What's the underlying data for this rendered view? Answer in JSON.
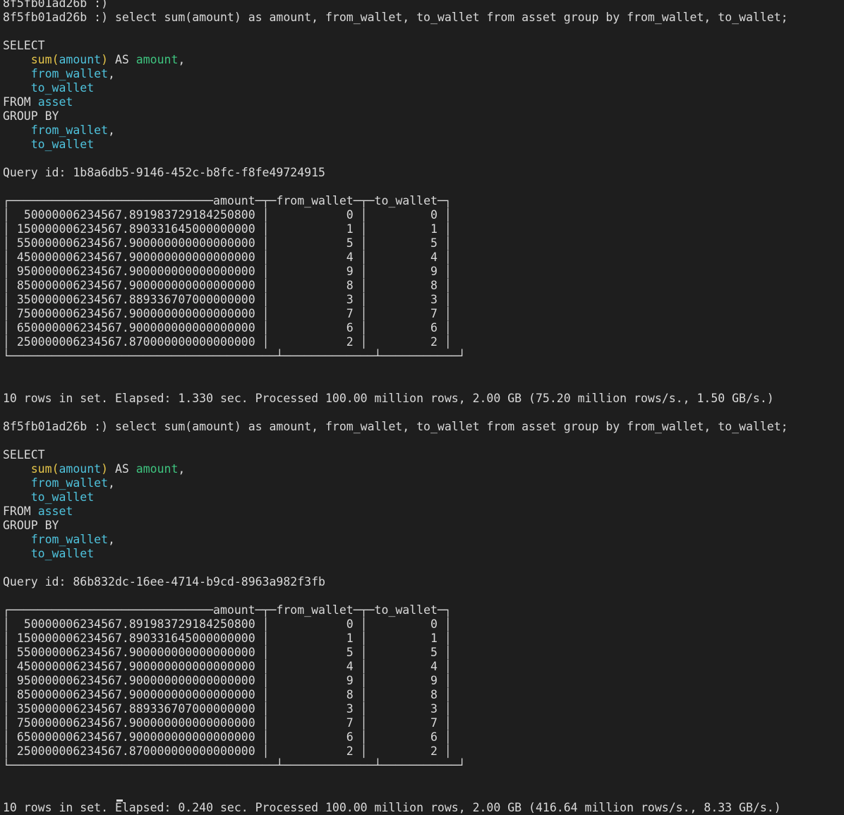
{
  "prompt": "8f5fb01ad26b :)",
  "query": "select sum(amount) as amount, from_wallet, to_wallet from asset group by from_wallet, to_wallet;",
  "formatted_sql": {
    "select": "SELECT",
    "sum_fn": "sum",
    "paren_open": "(",
    "sum_arg": "amount",
    "paren_close": ")",
    "as_kw": "AS",
    "alias": "amount",
    "col_from_wallet": "from_wallet",
    "col_to_wallet": "to_wallet",
    "from_kw": "FROM",
    "table": "asset",
    "group_by_kw": "GROUP BY"
  },
  "table_header": {
    "cols": [
      "amount",
      "from_wallet",
      "to_wallet"
    ]
  },
  "runs": [
    {
      "query_id_label": "Query id:",
      "query_id": "1b8a6db5-9146-452c-b8fc-f8fe49724915",
      "rows": [
        {
          "amount": "50000006234567.891983729184250800",
          "from_wallet": "0",
          "to_wallet": "0"
        },
        {
          "amount": "150000006234567.890331645000000000",
          "from_wallet": "1",
          "to_wallet": "1"
        },
        {
          "amount": "550000006234567.900000000000000000",
          "from_wallet": "5",
          "to_wallet": "5"
        },
        {
          "amount": "450000006234567.900000000000000000",
          "from_wallet": "4",
          "to_wallet": "4"
        },
        {
          "amount": "950000006234567.900000000000000000",
          "from_wallet": "9",
          "to_wallet": "9"
        },
        {
          "amount": "850000006234567.900000000000000000",
          "from_wallet": "8",
          "to_wallet": "8"
        },
        {
          "amount": "350000006234567.889336707000000000",
          "from_wallet": "3",
          "to_wallet": "3"
        },
        {
          "amount": "750000006234567.900000000000000000",
          "from_wallet": "7",
          "to_wallet": "7"
        },
        {
          "amount": "650000006234567.900000000000000000",
          "from_wallet": "6",
          "to_wallet": "6"
        },
        {
          "amount": "250000006234567.870000000000000000",
          "from_wallet": "2",
          "to_wallet": "2"
        }
      ],
      "summary": "10 rows in set. Elapsed: 1.330 sec. Processed 100.00 million rows, 2.00 GB (75.20 million rows/s., 1.50 GB/s.)"
    },
    {
      "query_id_label": "Query id:",
      "query_id": "86b832dc-16ee-4714-b9cd-8963a982f3fb",
      "rows": [
        {
          "amount": "50000006234567.891983729184250800",
          "from_wallet": "0",
          "to_wallet": "0"
        },
        {
          "amount": "150000006234567.890331645000000000",
          "from_wallet": "1",
          "to_wallet": "1"
        },
        {
          "amount": "550000006234567.900000000000000000",
          "from_wallet": "5",
          "to_wallet": "5"
        },
        {
          "amount": "450000006234567.900000000000000000",
          "from_wallet": "4",
          "to_wallet": "4"
        },
        {
          "amount": "950000006234567.900000000000000000",
          "from_wallet": "9",
          "to_wallet": "9"
        },
        {
          "amount": "850000006234567.900000000000000000",
          "from_wallet": "8",
          "to_wallet": "8"
        },
        {
          "amount": "350000006234567.889336707000000000",
          "from_wallet": "3",
          "to_wallet": "3"
        },
        {
          "amount": "750000006234567.900000000000000000",
          "from_wallet": "7",
          "to_wallet": "7"
        },
        {
          "amount": "650000006234567.900000000000000000",
          "from_wallet": "6",
          "to_wallet": "6"
        },
        {
          "amount": "250000006234567.870000000000000000",
          "from_wallet": "2",
          "to_wallet": "2"
        }
      ],
      "summary": "10 rows in set. Elapsed: 0.240 sec. Processed 100.00 million rows, 2.00 GB (416.64 million rows/s., 8.33 GB/s.)"
    }
  ],
  "colors": {
    "background": "#1e1e1e",
    "text": "#d9d9d9",
    "function": "#e5c54a",
    "identifier": "#4fc3dd",
    "alias": "#3ec47f"
  }
}
